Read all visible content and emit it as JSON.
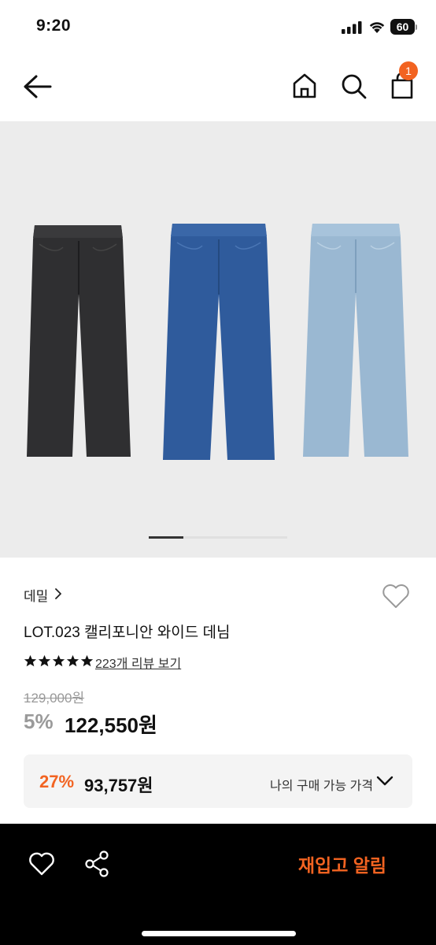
{
  "status_bar": {
    "time": "9:20",
    "battery": "60"
  },
  "nav": {
    "back_icon": "arrow-left-icon",
    "home_icon": "home-icon",
    "search_icon": "search-icon",
    "cart_icon": "cart-icon",
    "cart_count": "1"
  },
  "gallery": {
    "items": [
      {
        "name": "black-wash-jeans",
        "color": "#2f2f31"
      },
      {
        "name": "mid-blue-jeans",
        "color": "#2f5b9c"
      },
      {
        "name": "light-blue-jeans",
        "color": "#9ab8d2"
      }
    ],
    "page_indicator": {
      "current": 1,
      "total": 4
    }
  },
  "product": {
    "category": "데밀",
    "title": "LOT.023 캘리포니안 와이드 데님",
    "rating_stars": 5,
    "review_link": "223개 리뷰 보기",
    "original_price": "129,000원",
    "discount_rate": "5%",
    "sale_price": "122,550원"
  },
  "my_price": {
    "rate": "27%",
    "value": "93,757원",
    "label": "나의 구매 가능 가격"
  },
  "bottom_bar": {
    "restock_button": "재입고 알림"
  },
  "colors": {
    "accent": "#f26321",
    "bottom_bar_bg": "#000000",
    "image_bg": "#ececec"
  }
}
